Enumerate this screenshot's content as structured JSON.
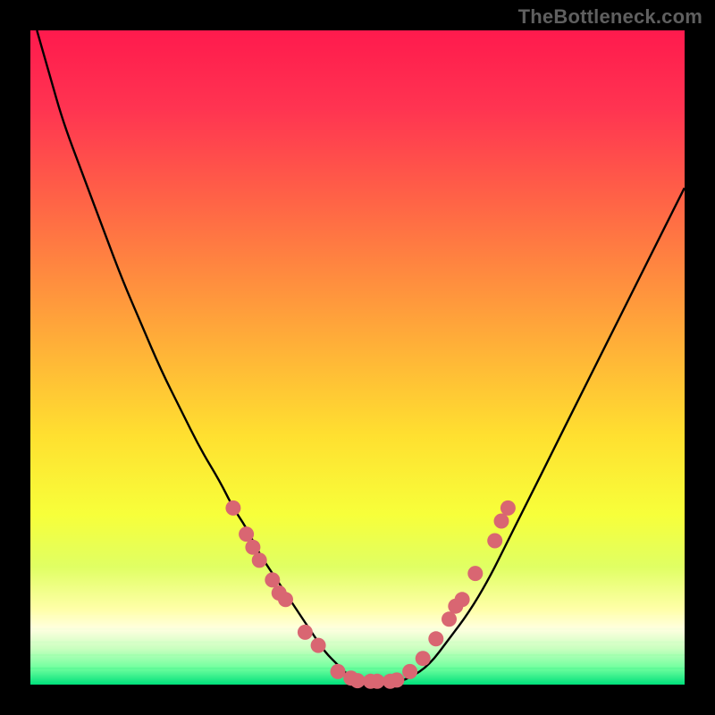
{
  "watermark": "TheBottleneck.com",
  "colors": {
    "frame": "#000000",
    "curve": "#000000",
    "marker_fill": "#d96672",
    "marker_stroke": "#c75563",
    "bottom_band_stroke": "#00e07b"
  },
  "chart_data": {
    "type": "line",
    "title": "",
    "xlabel": "",
    "ylabel": "",
    "xlim": [
      0,
      100
    ],
    "ylim": [
      0,
      100
    ],
    "grid": false,
    "legend": false,
    "annotations": [],
    "series": [
      {
        "name": "bottleneck-curve",
        "x": [
          1,
          3,
          5,
          8,
          11,
          14,
          17,
          20,
          23,
          26,
          29,
          31,
          33,
          35,
          37,
          39,
          41,
          43,
          45,
          47,
          49,
          52,
          55,
          58,
          61,
          64,
          67,
          70,
          73,
          76,
          80,
          84,
          88,
          92,
          96,
          100
        ],
        "y": [
          100,
          93,
          86,
          78,
          70,
          62,
          55,
          48,
          42,
          36,
          31,
          27,
          24,
          20,
          17,
          14,
          11,
          8,
          5,
          3,
          1,
          0,
          0,
          1,
          3,
          7,
          11,
          16,
          22,
          28,
          36,
          44,
          52,
          60,
          68,
          76
        ]
      }
    ],
    "markers": {
      "name": "highlighted-points",
      "points": [
        {
          "x": 31,
          "y": 27
        },
        {
          "x": 33,
          "y": 23
        },
        {
          "x": 34,
          "y": 21
        },
        {
          "x": 35,
          "y": 19
        },
        {
          "x": 37,
          "y": 16
        },
        {
          "x": 38,
          "y": 14
        },
        {
          "x": 39,
          "y": 13
        },
        {
          "x": 42,
          "y": 8
        },
        {
          "x": 44,
          "y": 6
        },
        {
          "x": 47,
          "y": 2
        },
        {
          "x": 49,
          "y": 1
        },
        {
          "x": 50,
          "y": 0.6
        },
        {
          "x": 52,
          "y": 0.5
        },
        {
          "x": 53,
          "y": 0.5
        },
        {
          "x": 55,
          "y": 0.5
        },
        {
          "x": 56,
          "y": 0.7
        },
        {
          "x": 58,
          "y": 2
        },
        {
          "x": 60,
          "y": 4
        },
        {
          "x": 62,
          "y": 7
        },
        {
          "x": 64,
          "y": 10
        },
        {
          "x": 65,
          "y": 12
        },
        {
          "x": 66,
          "y": 13
        },
        {
          "x": 68,
          "y": 17
        },
        {
          "x": 71,
          "y": 22
        },
        {
          "x": 72,
          "y": 25
        },
        {
          "x": 73,
          "y": 27
        }
      ]
    },
    "gradient_background": {
      "description": "vertical gradient fill of plot area",
      "stops": [
        {
          "pos": 0.0,
          "color": "#ff1a4d"
        },
        {
          "pos": 0.12,
          "color": "#ff3451"
        },
        {
          "pos": 0.28,
          "color": "#ff6a45"
        },
        {
          "pos": 0.45,
          "color": "#ffa53a"
        },
        {
          "pos": 0.62,
          "color": "#ffe030"
        },
        {
          "pos": 0.74,
          "color": "#f7ff3a"
        },
        {
          "pos": 0.82,
          "color": "#e0ff63"
        },
        {
          "pos": 0.885,
          "color": "#ffffa8"
        },
        {
          "pos": 0.915,
          "color": "#ffffe0"
        },
        {
          "pos": 0.945,
          "color": "#c9ffbf"
        },
        {
          "pos": 0.975,
          "color": "#6fff9e"
        },
        {
          "pos": 1.0,
          "color": "#00e07b"
        }
      ]
    }
  }
}
